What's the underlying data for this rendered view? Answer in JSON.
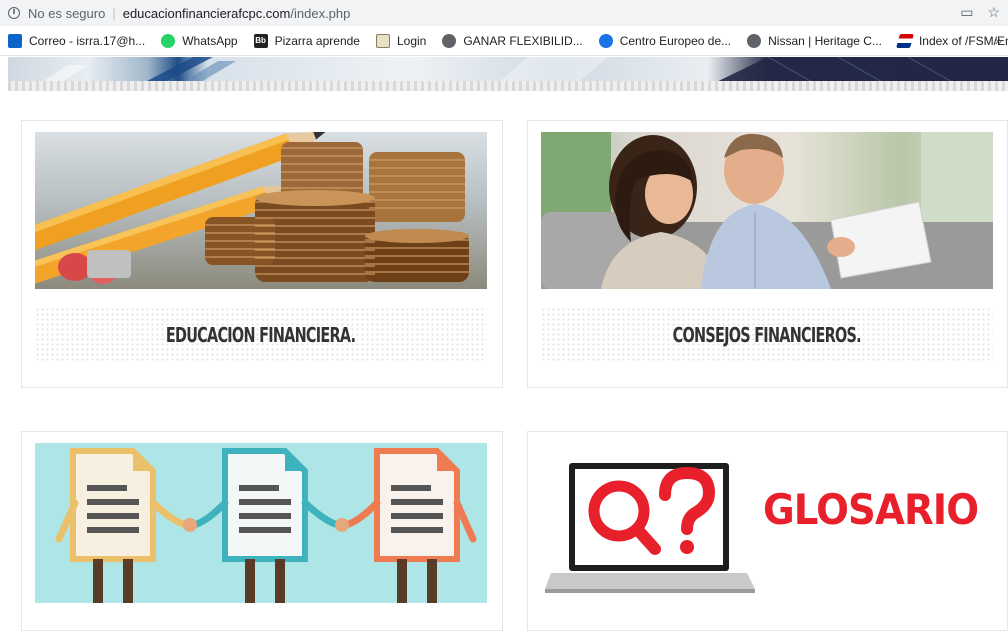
{
  "browser": {
    "security_label": "No es seguro",
    "url_host": "educacionfinancierafcpc.com",
    "url_path": "/index.php",
    "bookmarks": [
      {
        "label": "Correo - isrra.17@h...",
        "icon": "outlook-icon"
      },
      {
        "label": "WhatsApp",
        "icon": "whatsapp-icon"
      },
      {
        "label": "Pizarra aprende",
        "icon": "blackboard-icon"
      },
      {
        "label": "Login",
        "icon": "login-icon"
      },
      {
        "label": "GANAR FLEXIBILID...",
        "icon": "globe-icon"
      },
      {
        "label": "Centro Europeo de...",
        "icon": "shield-icon"
      },
      {
        "label": "Nissan | Heritage C...",
        "icon": "globe-icon"
      },
      {
        "label": "Index of /FSM/Engi...",
        "icon": "flag-icon"
      }
    ],
    "more_label": "»"
  },
  "cards": [
    {
      "title": "EDUCACION FINANCIERA.",
      "image": "coins-and-pencils-photo"
    },
    {
      "title": "CONSEJOS FINANCIEROS.",
      "image": "couple-reviewing-document-photo"
    },
    {
      "title": "",
      "image": "document-characters-illustration"
    },
    {
      "title": "",
      "image": "glosario-illustration",
      "image_text": "GLOSARIO"
    }
  ]
}
